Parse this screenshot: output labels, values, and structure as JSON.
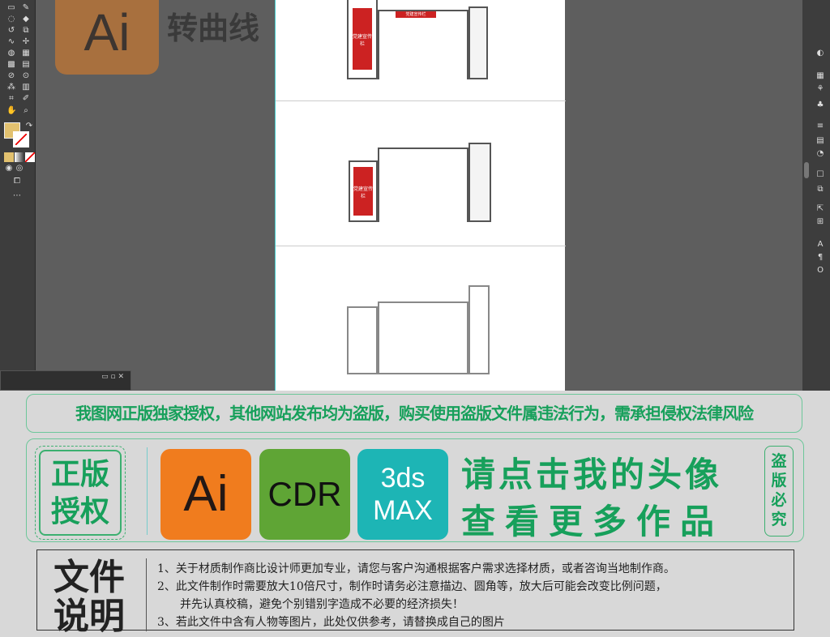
{
  "canvas": {
    "logo_text": "Ai",
    "title": "转曲线"
  },
  "artboard": {
    "board_label": "党建宣传栏",
    "board_label_2": "党建宣传栏"
  },
  "banner": {
    "text": "我图网正版独家授权，其他网站发布均为盗版，购买使用盗版文件属违法行为，需承担侵权法律风险"
  },
  "promo": {
    "badge_left": [
      "正版",
      "授权"
    ],
    "software": [
      {
        "label": "Ai",
        "color": "#f07c1e"
      },
      {
        "label": "CDR",
        "color": "#5fa535"
      },
      {
        "label": "3ds",
        "label2": "MAX",
        "color": "#1db5b5"
      }
    ],
    "line1": "请点击我的头像",
    "line2": "查看更多作品",
    "badge_right": "盗版必究"
  },
  "notes": {
    "title": "文件说明",
    "items": [
      "1、关于材质制作商比设计师更加专业，请您与客户沟通根据客户需求选择材质，或者咨询当地制作商。",
      "2、此文件制作时需要放大10倍尺寸，制作时请务必注意描边、圆角等，放大后可能会改变比例问题，",
      "并先认真校稿，避免个别错别字造成不必要的经济损失！",
      "3、若此文件中含有人物等图片，此处仅供参考，请替换成自己的图片"
    ]
  },
  "colors": {
    "accent_green": "#17a05b",
    "ai_orange": "#f07c1e",
    "cdr_green": "#5fa535",
    "max_teal": "#1db5b5"
  }
}
